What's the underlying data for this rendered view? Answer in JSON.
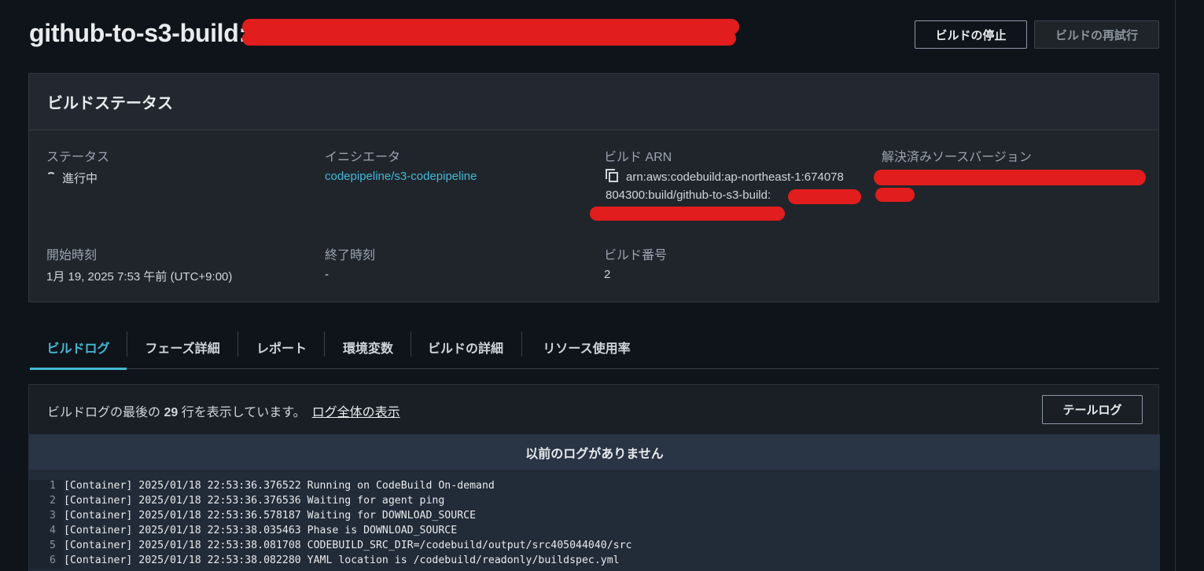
{
  "header": {
    "title": "github-to-s3-build:",
    "stop_button": "ビルドの停止",
    "retry_button": "ビルドの再試行"
  },
  "status_card": {
    "title": "ビルドステータス",
    "status_label": "ステータス",
    "status_value": "進行中",
    "initiator_label": "イニシエータ",
    "initiator_value": "codepipeline/s3-codepipeline",
    "arn_label": "ビルド ARN",
    "arn_line1": "arn:aws:codebuild:ap-northeast-1:674078",
    "arn_line2": "804300:build/github-to-s3-build:",
    "source_version_label": "解決済みソースバージョン",
    "start_time_label": "開始時刻",
    "start_time_value": "1月 19, 2025 7:53 午前 (UTC+9:00)",
    "end_time_label": "終了時刻",
    "end_time_value": "-",
    "build_number_label": "ビルド番号",
    "build_number_value": "2"
  },
  "tabs": [
    {
      "label": "ビルドログ"
    },
    {
      "label": "フェーズ詳細"
    },
    {
      "label": "レポート"
    },
    {
      "label": "環境変数"
    },
    {
      "label": "ビルドの詳細"
    },
    {
      "label": "リソース使用率"
    }
  ],
  "log": {
    "desc_prefix": "ビルドログの最後の",
    "desc_count": "29",
    "desc_suffix": "行を表示しています。",
    "full_log_link": "ログ全体の表示",
    "tail_button": "テールログ",
    "banner": "以前のログがありません",
    "lines": [
      {
        "n": "1",
        "text": "[Container] 2025/01/18 22:53:36.376522 Running on CodeBuild On-demand"
      },
      {
        "n": "2",
        "text": "[Container] 2025/01/18 22:53:36.376536 Waiting for agent ping"
      },
      {
        "n": "3",
        "text": "[Container] 2025/01/18 22:53:36.578187 Waiting for DOWNLOAD_SOURCE"
      },
      {
        "n": "4",
        "text": "[Container] 2025/01/18 22:53:38.035463 Phase is DOWNLOAD_SOURCE"
      },
      {
        "n": "5",
        "text": "[Container] 2025/01/18 22:53:38.081708 CODEBUILD_SRC_DIR=/codebuild/output/src405044040/src"
      },
      {
        "n": "6",
        "text": "[Container] 2025/01/18 22:53:38.082280 YAML location is /codebuild/readonly/buildspec.yml"
      }
    ]
  },
  "colors": {
    "accent": "#44b9d6",
    "redaction": "#e11d1d"
  }
}
